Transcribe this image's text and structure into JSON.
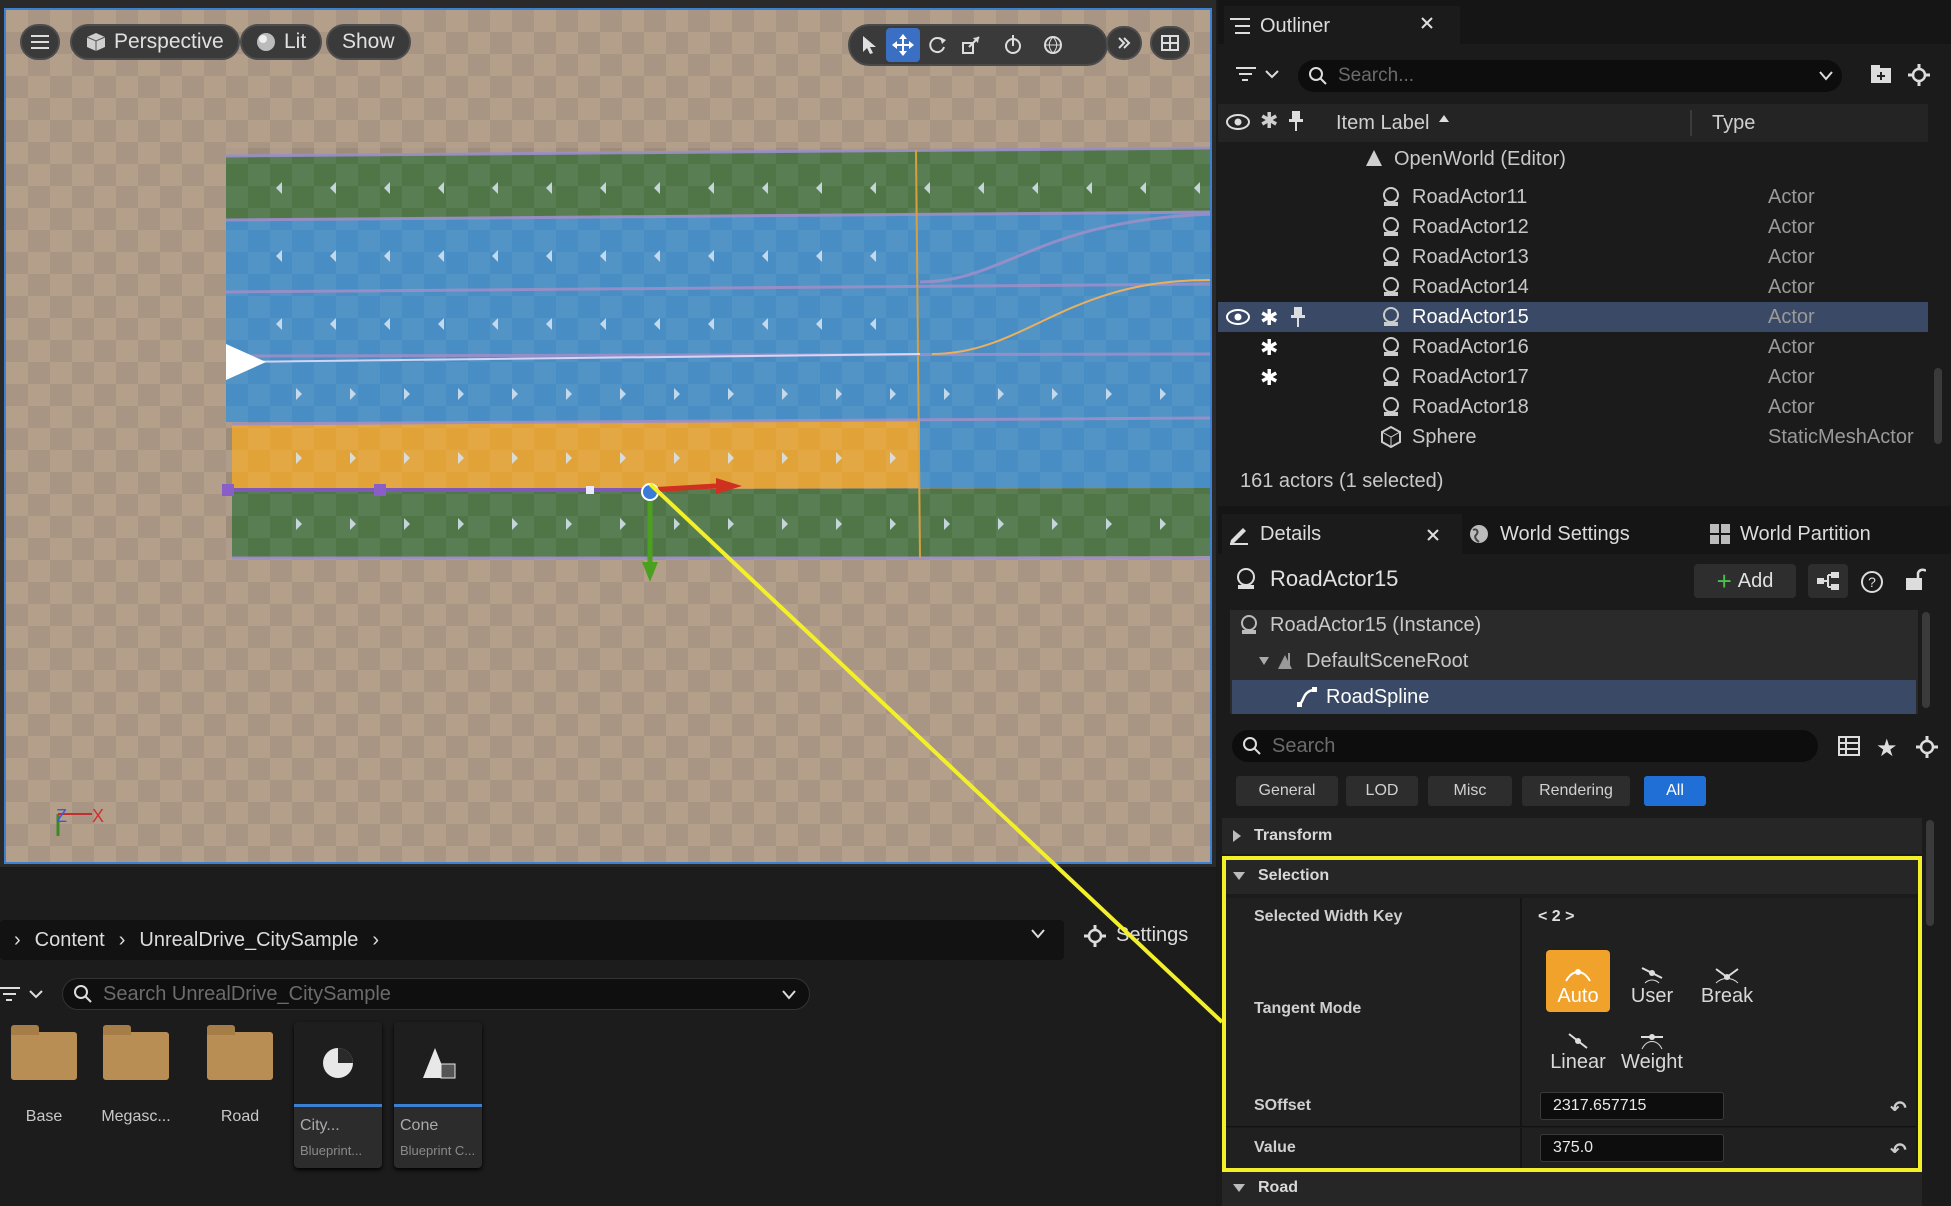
{
  "viewport": {
    "mode_label": "Perspective",
    "lit_label": "Lit",
    "show_label": "Show",
    "axis_z": "Z",
    "axis_x": "X"
  },
  "content_browser": {
    "breadcrumb": [
      "Content",
      "UnrealDrive_CitySample"
    ],
    "settings_label": "Settings",
    "search_placeholder": "Search UnrealDrive_CitySample",
    "folders": [
      {
        "name": "Base"
      },
      {
        "name": "Megasc..."
      },
      {
        "name": "Road"
      }
    ],
    "assets": [
      {
        "name": "City...",
        "type": "Blueprint..."
      },
      {
        "name": "Cone",
        "type": "Blueprint C..."
      }
    ]
  },
  "outliner": {
    "title": "Outliner",
    "search_placeholder": "Search...",
    "col_label": "Item Label",
    "col_type": "Type",
    "world_row": "OpenWorld (Editor)",
    "rows": [
      {
        "label": "RoadActor11",
        "type": "Actor",
        "eye": "",
        "star": "",
        "pin": "",
        "selected": false
      },
      {
        "label": "RoadActor12",
        "type": "Actor",
        "eye": "",
        "star": "",
        "pin": "",
        "selected": false
      },
      {
        "label": "RoadActor13",
        "type": "Actor",
        "eye": "",
        "star": "",
        "pin": "",
        "selected": false
      },
      {
        "label": "RoadActor14",
        "type": "Actor",
        "eye": "",
        "star": "",
        "pin": "",
        "selected": false
      },
      {
        "label": "RoadActor15",
        "type": "Actor",
        "eye": "◉",
        "star": "✱",
        "pin": "📌",
        "selected": true
      },
      {
        "label": "RoadActor16",
        "type": "Actor",
        "eye": "",
        "star": "✱",
        "pin": "",
        "selected": false
      },
      {
        "label": "RoadActor17",
        "type": "Actor",
        "eye": "",
        "star": "✱",
        "pin": "",
        "selected": false
      },
      {
        "label": "RoadActor18",
        "type": "Actor",
        "eye": "",
        "star": "",
        "pin": "",
        "selected": false
      },
      {
        "label": "Sphere",
        "type": "StaticMeshActor",
        "eye": "",
        "star": "",
        "pin": "",
        "selected": false
      }
    ],
    "status": "161 actors (1 selected)"
  },
  "details": {
    "tab_details": "Details",
    "tab_world_settings": "World Settings",
    "tab_world_partition": "World Partition",
    "actor_name": "RoadActor15",
    "add_label": "Add",
    "tree": {
      "instance": "RoadActor15 (Instance)",
      "root": "DefaultSceneRoot",
      "spline": "RoadSpline"
    },
    "search_placeholder": "Search",
    "filters": [
      "General",
      "LOD",
      "Misc",
      "Rendering",
      "All"
    ],
    "categories": {
      "transform": "Transform",
      "selection": "Selection",
      "road": "Road"
    },
    "props": {
      "selected_width_key_label": "Selected Width Key",
      "selected_width_key_value": "< 2 >",
      "tangent_mode_label": "Tangent Mode",
      "tangent_modes": [
        "Auto",
        "User",
        "Break",
        "Linear",
        "Weight"
      ],
      "soffset_label": "SOffset",
      "soffset_value": "2317.657715",
      "value_label": "Value",
      "value_value": "375.0"
    }
  },
  "colors": {
    "accent": "#1f6fd6",
    "selection_row": "#3a4a66",
    "highlight": "#f3f02a",
    "tangent_active": "#f0a22a",
    "lane_green": "#4f7a4a",
    "lane_blue": "#4e93cc",
    "lane_yellow": "#e8a93a"
  }
}
